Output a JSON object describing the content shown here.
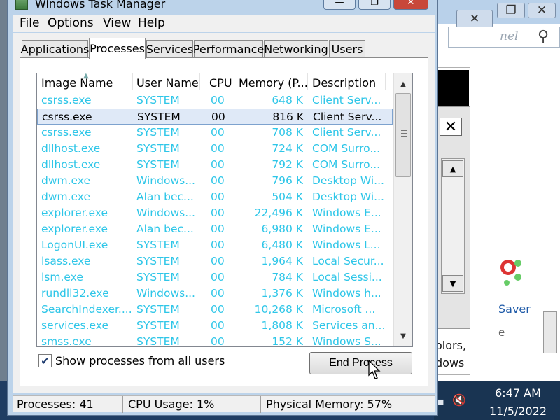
{
  "window": {
    "title": "Windows Task Manager",
    "minimize_glyph": "—",
    "maximize_glyph": "❐",
    "close_glyph": "✕"
  },
  "menu": [
    "File",
    "Options",
    "View",
    "Help"
  ],
  "tabs": [
    {
      "label": "Applications",
      "active": false
    },
    {
      "label": "Processes",
      "active": true
    },
    {
      "label": "Services",
      "active": false
    },
    {
      "label": "Performance",
      "active": false
    },
    {
      "label": "Networking",
      "active": false
    },
    {
      "label": "Users",
      "active": false
    }
  ],
  "columns": {
    "image_name": "Image Name",
    "user_name": "User Name",
    "cpu": "CPU",
    "memory": "Memory (P...",
    "description": "Description"
  },
  "processes": [
    {
      "name": "csrss.exe",
      "user": "SYSTEM",
      "cpu": "00",
      "memory": "648 K",
      "description": "Client Serv...",
      "selected": false
    },
    {
      "name": "csrss.exe",
      "user": "SYSTEM",
      "cpu": "00",
      "memory": "816 K",
      "description": "Client Serv...",
      "selected": true
    },
    {
      "name": "csrss.exe",
      "user": "SYSTEM",
      "cpu": "00",
      "memory": "708 K",
      "description": "Client Serv...",
      "selected": false
    },
    {
      "name": "dllhost.exe",
      "user": "SYSTEM",
      "cpu": "00",
      "memory": "724 K",
      "description": "COM Surro...",
      "selected": false
    },
    {
      "name": "dllhost.exe",
      "user": "SYSTEM",
      "cpu": "00",
      "memory": "792 K",
      "description": "COM Surro...",
      "selected": false
    },
    {
      "name": "dwm.exe",
      "user": "Windows...",
      "cpu": "00",
      "memory": "796 K",
      "description": "Desktop Wi...",
      "selected": false
    },
    {
      "name": "dwm.exe",
      "user": "Alan bec...",
      "cpu": "00",
      "memory": "504 K",
      "description": "Desktop Wi...",
      "selected": false
    },
    {
      "name": "explorer.exe",
      "user": "Windows...",
      "cpu": "00",
      "memory": "22,496 K",
      "description": "Windows E...",
      "selected": false
    },
    {
      "name": "explorer.exe",
      "user": "Alan bec...",
      "cpu": "00",
      "memory": "6,980 K",
      "description": "Windows E...",
      "selected": false
    },
    {
      "name": "LogonUI.exe",
      "user": "SYSTEM",
      "cpu": "00",
      "memory": "6,480 K",
      "description": "Windows L...",
      "selected": false
    },
    {
      "name": "lsass.exe",
      "user": "SYSTEM",
      "cpu": "00",
      "memory": "1,964 K",
      "description": "Local Secur...",
      "selected": false
    },
    {
      "name": "lsm.exe",
      "user": "SYSTEM",
      "cpu": "00",
      "memory": "784 K",
      "description": "Local Sessi...",
      "selected": false
    },
    {
      "name": "rundll32.exe",
      "user": "Windows...",
      "cpu": "00",
      "memory": "1,376 K",
      "description": "Windows h...",
      "selected": false
    },
    {
      "name": "SearchIndexer....",
      "user": "SYSTEM",
      "cpu": "00",
      "memory": "10,268 K",
      "description": "Microsoft ...",
      "selected": false
    },
    {
      "name": "services.exe",
      "user": "SYSTEM",
      "cpu": "00",
      "memory": "1,808 K",
      "description": "Services an...",
      "selected": false
    },
    {
      "name": "smss.exe",
      "user": "SYSTEM",
      "cpu": "00",
      "memory": "152 K",
      "description": "Windows S...",
      "selected": false
    }
  ],
  "show_all_users": {
    "label": "Show processes from all users",
    "checked": true,
    "check_glyph": "✔"
  },
  "end_process_label": "End Process",
  "status": {
    "processes": "Processes: 41",
    "cpu_usage": "CPU Usage: 1%",
    "physical_memory": "Physical Memory: 57%"
  },
  "background": {
    "search_placeholder": "nel",
    "saver_text": "Saver",
    "e_text": "e",
    "colors_text": "olors,",
    "dows_text": "dows",
    "restore_glyph": "❐",
    "close_glyph": "✕",
    "dialog_close_glyph": "✕"
  },
  "taskbar": {
    "time": "6:47 AM",
    "date": "11/5/2022"
  },
  "colors": {
    "process_text": "#2ec6e8",
    "selected_row_bg": "#dfe9f7",
    "window_frame": "#bcd3ea",
    "taskbar": "#1f3d63"
  }
}
